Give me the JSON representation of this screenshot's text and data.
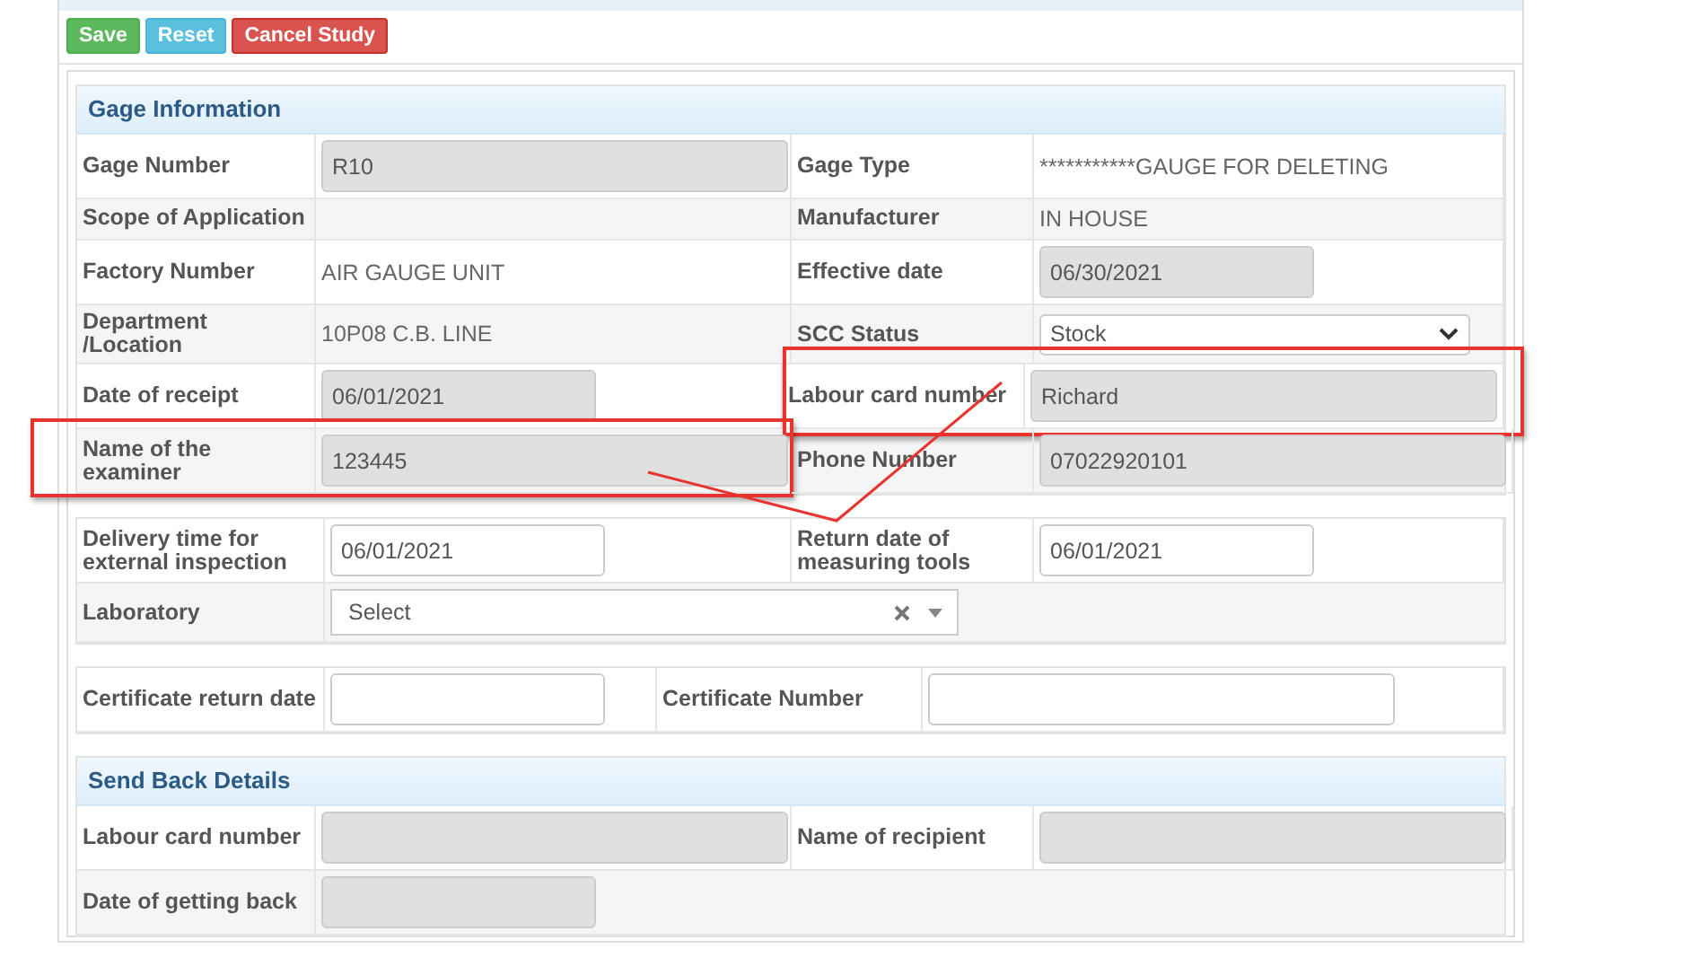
{
  "toolbar": {
    "buttons": [
      {
        "label": "Save",
        "kind": "success"
      },
      {
        "label": "Reset",
        "kind": "info"
      },
      {
        "label": "Cancel Study",
        "kind": "danger"
      }
    ]
  },
  "sections": [
    {
      "title": "Gage Information",
      "rows": [
        {
          "cells": [
            {
              "label": "Gage Number",
              "field": {
                "kind": "text",
                "readonly": true,
                "value": "R10"
              }
            },
            {
              "label": "Gage Type",
              "field": {
                "kind": "plain",
                "value": "***********GAUGE FOR DELETING"
              }
            }
          ]
        },
        {
          "cells": [
            {
              "label": "Scope of Application",
              "field": {
                "kind": "plain"
              }
            },
            {
              "label": "Manufacturer",
              "field": {
                "kind": "plain",
                "value": "IN HOUSE"
              }
            }
          ]
        },
        {
          "cells": [
            {
              "label": "Factory Number",
              "field": {
                "kind": "plain",
                "value": "AIR GAUGE UNIT"
              }
            },
            {
              "label": "Effective date",
              "field": {
                "kind": "date",
                "readonly": true,
                "value": "06/30/2021"
              }
            }
          ]
        },
        {
          "cells": [
            {
              "label": "Department /Location",
              "field": {
                "kind": "plain",
                "value": "10P08 C.B. LINE"
              }
            },
            {
              "label": "SCC Status",
              "field": {
                "kind": "select",
                "value": "Stock"
              }
            }
          ]
        },
        {
          "cells": [
            {
              "label": "Date of receipt",
              "field": {
                "kind": "date",
                "readonly": true,
                "value": "06/01/2021"
              }
            },
            {
              "label": "Labour card number",
              "highlighted": true,
              "field": {
                "kind": "text",
                "readonly": true,
                "value": "Richard"
              }
            }
          ]
        },
        {
          "cells": [
            {
              "label": "Name of the examiner",
              "highlighted": true,
              "field": {
                "kind": "text",
                "readonly": true,
                "value": "123445"
              }
            },
            {
              "label": "Phone Number",
              "field": {
                "kind": "text",
                "readonly": true,
                "value": "07022920101"
              }
            }
          ]
        }
      ]
    },
    {
      "rows": [
        {
          "cells": [
            {
              "label": "Delivery time for external inspection",
              "field": {
                "kind": "date",
                "readonly": false,
                "value": "06/01/2021"
              }
            },
            {
              "label": "Return date of measuring tools",
              "field": {
                "kind": "date",
                "readonly": false,
                "value": "06/01/2021"
              }
            }
          ]
        },
        {
          "cells": [
            {
              "label": "Laboratory",
              "field": {
                "kind": "combo",
                "value": "Select"
              }
            }
          ]
        }
      ]
    },
    {
      "rows": [
        {
          "cells": [
            {
              "label": "Certificate return date",
              "field": {
                "kind": "date",
                "readonly": false
              }
            },
            {
              "label": "Certificate Number",
              "field": {
                "kind": "text",
                "readonly": false
              }
            }
          ]
        }
      ]
    },
    {
      "title": "Send Back Details",
      "rows": [
        {
          "cells": [
            {
              "label": "Labour card number",
              "field": {
                "kind": "text",
                "readonly": true
              }
            },
            {
              "label": "Name of recipient",
              "field": {
                "kind": "text",
                "readonly": true
              }
            }
          ]
        },
        {
          "cells": [
            {
              "label": "Date of getting back",
              "field": {
                "kind": "date",
                "readonly": true
              }
            }
          ]
        }
      ]
    }
  ],
  "connector": true
}
